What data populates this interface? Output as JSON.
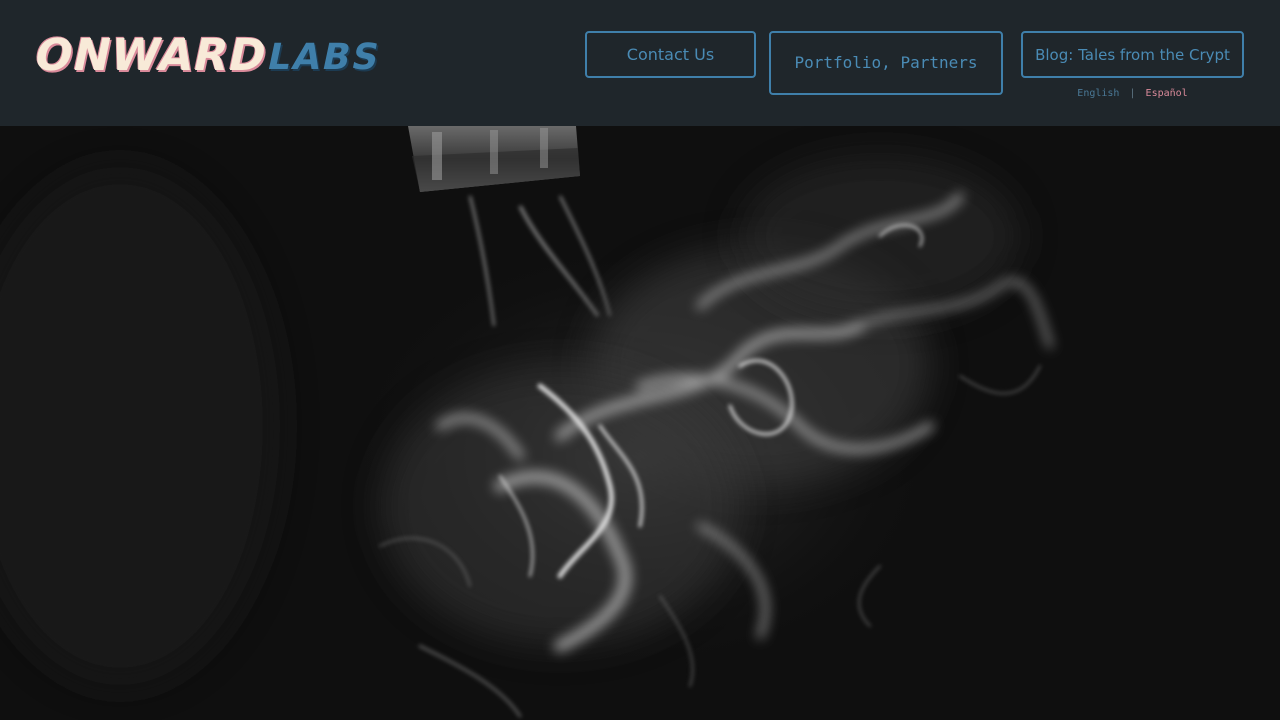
{
  "header": {
    "logo": {
      "main": "ONWARD",
      "sub": "LABS"
    },
    "nav": {
      "contact_label": "Contact Us",
      "portfolio_label": "Portfolio, Partners",
      "blog_label": "Blog: Tales from the Crypt"
    },
    "language": {
      "english": "English",
      "separator": "|",
      "spanish": "Español"
    }
  },
  "hero": {
    "image_subject": "smoke-from-faucet-image"
  },
  "colors": {
    "header_bg": "#1f262b",
    "accent_blue": "#3f7faa",
    "accent_pink": "#d98a9a",
    "logo_cream": "#f8ead8"
  }
}
